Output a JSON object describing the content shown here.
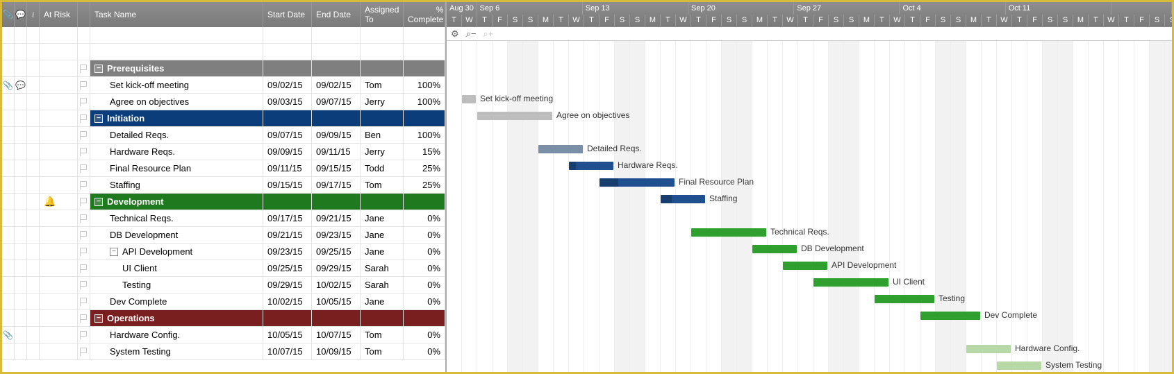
{
  "columns": {
    "atRisk": "At Risk",
    "taskName": "Task Name",
    "startDate": "Start Date",
    "endDate": "End Date",
    "assignedTo": "Assigned To",
    "pctComplete": "% Complete"
  },
  "iconHeaders": {
    "attach": "📎",
    "comment": "💬",
    "info": "i"
  },
  "rowSpec": [
    {
      "type": "blank"
    },
    {
      "type": "blank"
    },
    {
      "type": "header",
      "color": "gray",
      "collapse": "−",
      "task": "Prerequisites"
    },
    {
      "type": "task",
      "indent": 1,
      "task": "Set kick-off meeting",
      "start": "09/02/15",
      "end": "09/02/15",
      "assigned": "Tom",
      "pct": "100%",
      "attach": true,
      "comment": true
    },
    {
      "type": "task",
      "indent": 1,
      "task": "Agree on objectives",
      "start": "09/03/15",
      "end": "09/07/15",
      "assigned": "Jerry",
      "pct": "100%"
    },
    {
      "type": "header",
      "color": "blue",
      "collapse": "−",
      "task": "Initiation"
    },
    {
      "type": "task",
      "indent": 1,
      "task": "Detailed Reqs.",
      "start": "09/07/15",
      "end": "09/09/15",
      "assigned": "Ben",
      "pct": "100%"
    },
    {
      "type": "task",
      "indent": 1,
      "task": "Hardware Reqs.",
      "start": "09/09/15",
      "end": "09/11/15",
      "assigned": "Jerry",
      "pct": "15%"
    },
    {
      "type": "task",
      "indent": 1,
      "task": "Final Resource Plan",
      "start": "09/11/15",
      "end": "09/15/15",
      "assigned": "Todd",
      "pct": "25%"
    },
    {
      "type": "task",
      "indent": 1,
      "task": "Staffing",
      "start": "09/15/15",
      "end": "09/17/15",
      "assigned": "Tom",
      "pct": "25%"
    },
    {
      "type": "header",
      "color": "green",
      "collapse": "−",
      "task": "Development",
      "bell": true
    },
    {
      "type": "task",
      "indent": 1,
      "task": "Technical Reqs.",
      "start": "09/17/15",
      "end": "09/21/15",
      "assigned": "Jane",
      "pct": "0%"
    },
    {
      "type": "task",
      "indent": 1,
      "task": "DB Development",
      "start": "09/21/15",
      "end": "09/23/15",
      "assigned": "Jane",
      "pct": "0%"
    },
    {
      "type": "task",
      "indent": 1,
      "task": "API Development",
      "start": "09/23/15",
      "end": "09/25/15",
      "assigned": "Jane",
      "pct": "0%",
      "sub": "−"
    },
    {
      "type": "task",
      "indent": 2,
      "task": "UI Client",
      "start": "09/25/15",
      "end": "09/29/15",
      "assigned": "Sarah",
      "pct": "0%"
    },
    {
      "type": "task",
      "indent": 2,
      "task": "Testing",
      "start": "09/29/15",
      "end": "10/02/15",
      "assigned": "Sarah",
      "pct": "0%"
    },
    {
      "type": "task",
      "indent": 1,
      "task": "Dev Complete",
      "start": "10/02/15",
      "end": "10/05/15",
      "assigned": "Jane",
      "pct": "0%"
    },
    {
      "type": "header",
      "color": "darkred",
      "collapse": "−",
      "task": "Operations"
    },
    {
      "type": "task",
      "indent": 1,
      "task": "Hardware Config.",
      "start": "10/05/15",
      "end": "10/07/15",
      "assigned": "Tom",
      "pct": "0%",
      "attach": true
    },
    {
      "type": "task",
      "indent": 1,
      "task": "System Testing",
      "start": "10/07/15",
      "end": "10/09/15",
      "assigned": "Tom",
      "pct": "0%"
    }
  ],
  "gantt": {
    "toolbar": {
      "gear": "⚙",
      "zoomOut": "⌕−",
      "zoomIn": "⌕+"
    },
    "startDay": 0,
    "dayWidth": 22,
    "months": [
      {
        "label": "Aug 30",
        "span": 2
      },
      {
        "label": "Sep 6",
        "span": 7
      },
      {
        "label": "Sep 13",
        "span": 7
      },
      {
        "label": "Sep 20",
        "span": 7
      },
      {
        "label": "Sep 27",
        "span": 7
      },
      {
        "label": "Oct 4",
        "span": 7
      },
      {
        "label": "Oct 11",
        "span": 7
      },
      {
        "label": "",
        "span": 4
      }
    ],
    "days": [
      "T",
      "W",
      "T",
      "F",
      "S",
      "S",
      "M",
      "T",
      "W",
      "T",
      "F",
      "S",
      "S",
      "M",
      "T",
      "W",
      "T",
      "F",
      "S",
      "S",
      "M",
      "T",
      "W",
      "T",
      "F",
      "S",
      "S",
      "M",
      "T",
      "W",
      "T",
      "F",
      "S",
      "S",
      "M",
      "T",
      "W",
      "T",
      "F",
      "S",
      "S",
      "M",
      "T",
      "W",
      "T",
      "F",
      "S",
      "S"
    ],
    "weekend": [
      4,
      5,
      11,
      12,
      18,
      19,
      25,
      26,
      32,
      33,
      39,
      40,
      46,
      47
    ],
    "bars": [
      null,
      null,
      null,
      {
        "startCol": 1,
        "span": 1,
        "color": "gray",
        "label": "Set kick-off meeting"
      },
      {
        "startCol": 2,
        "span": 5,
        "color": "gray",
        "label": "Agree on objectives"
      },
      null,
      {
        "startCol": 6,
        "span": 3,
        "color": "bluei",
        "label": "Detailed Reqs.",
        "progress": 100
      },
      {
        "startCol": 8,
        "span": 3,
        "color": "blue",
        "label": "Hardware Reqs.",
        "progress": 15
      },
      {
        "startCol": 10,
        "span": 5,
        "color": "blue",
        "label": "Final Resource Plan",
        "progress": 25
      },
      {
        "startCol": 14,
        "span": 3,
        "color": "blue",
        "label": "Staffing",
        "progress": 25
      },
      null,
      {
        "startCol": 16,
        "span": 5,
        "color": "green",
        "label": "Technical Reqs."
      },
      {
        "startCol": 20,
        "span": 3,
        "color": "green",
        "label": "DB Development"
      },
      {
        "startCol": 22,
        "span": 3,
        "color": "green",
        "label": "API Development"
      },
      {
        "startCol": 24,
        "span": 5,
        "color": "green",
        "label": "UI Client"
      },
      {
        "startCol": 28,
        "span": 4,
        "color": "green",
        "label": "Testing"
      },
      {
        "startCol": 31,
        "span": 4,
        "color": "green",
        "label": "Dev Complete"
      },
      null,
      {
        "startCol": 34,
        "span": 3,
        "color": "greenl",
        "label": "Hardware Config."
      },
      {
        "startCol": 36,
        "span": 3,
        "color": "greenl",
        "label": "System Testing"
      }
    ]
  }
}
